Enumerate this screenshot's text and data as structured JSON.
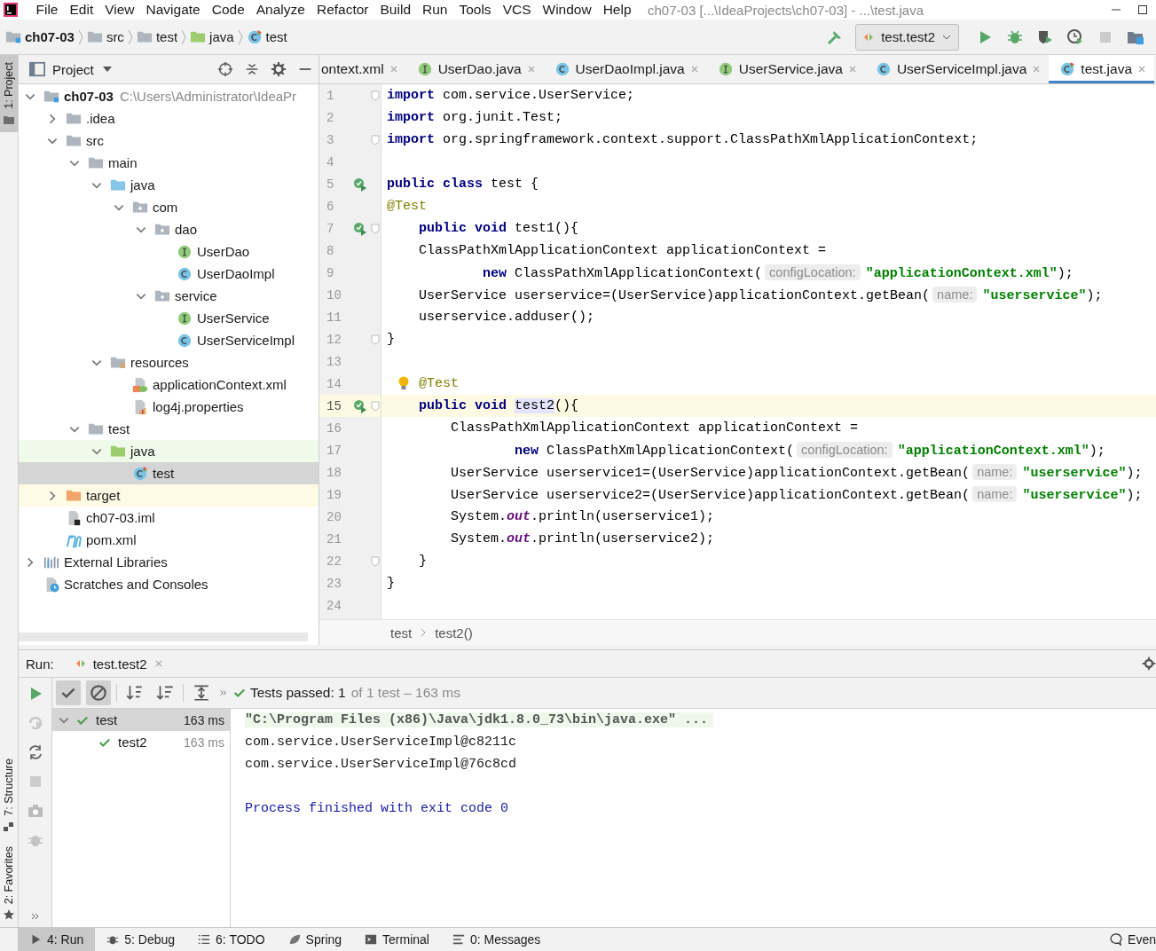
{
  "menu": [
    "File",
    "Edit",
    "View",
    "Navigate",
    "Code",
    "Analyze",
    "Refactor",
    "Build",
    "Run",
    "Tools",
    "VCS",
    "Window",
    "Help"
  ],
  "window_title": "ch07-03 [...\\IdeaProjects\\ch07-03] - ...\\test.java",
  "navigation": {
    "breadcrumbs": [
      {
        "label": "ch07-03",
        "kind": "module"
      },
      {
        "label": "src",
        "kind": "folder"
      },
      {
        "label": "test",
        "kind": "folder"
      },
      {
        "label": "java",
        "kind": "folder-test"
      },
      {
        "label": "test",
        "kind": "test-class"
      }
    ],
    "run_config": "test.test2"
  },
  "stripe_top": [
    {
      "label": "1: Project",
      "selected": true
    }
  ],
  "stripe_bottom": [
    {
      "label": "7: Structure",
      "selected": false
    },
    {
      "label": "2: Favorites",
      "selected": false
    }
  ],
  "project": {
    "title": "Project",
    "tree": [
      {
        "label": "ch07-03",
        "path": "C:\\Users\\Administrator\\IdeaPr",
        "kind": "module",
        "expanded": true,
        "selected": false,
        "children": [
          {
            "label": ".idea",
            "kind": "folder",
            "expanded": false,
            "selected": false
          },
          {
            "label": "src",
            "kind": "folder",
            "expanded": true,
            "selected": false,
            "children": [
              {
                "label": "main",
                "kind": "folder",
                "expanded": true,
                "selected": false,
                "children": [
                  {
                    "label": "java",
                    "kind": "folder-src",
                    "expanded": true,
                    "selected": false,
                    "children": [
                      {
                        "label": "com",
                        "kind": "package",
                        "expanded": true,
                        "selected": false,
                        "children": [
                          {
                            "label": "dao",
                            "kind": "package",
                            "expanded": true,
                            "selected": false,
                            "children": [
                              {
                                "label": "UserDao",
                                "kind": "interface",
                                "selected": false
                              },
                              {
                                "label": "UserDaoImpl",
                                "kind": "class",
                                "selected": false
                              }
                            ]
                          },
                          {
                            "label": "service",
                            "kind": "package",
                            "expanded": true,
                            "selected": false,
                            "children": [
                              {
                                "label": "UserService",
                                "kind": "interface",
                                "selected": false
                              },
                              {
                                "label": "UserServiceImpl",
                                "kind": "class",
                                "selected": false
                              }
                            ]
                          }
                        ]
                      }
                    ]
                  },
                  {
                    "label": "resources",
                    "kind": "folder-res",
                    "expanded": true,
                    "selected": false,
                    "children": [
                      {
                        "label": "applicationContext.xml",
                        "kind": "xml",
                        "selected": false
                      },
                      {
                        "label": "log4j.properties",
                        "kind": "properties",
                        "selected": false
                      }
                    ]
                  }
                ]
              },
              {
                "label": "test",
                "kind": "folder",
                "expanded": true,
                "selected": false,
                "children": [
                  {
                    "label": "java",
                    "kind": "folder-test",
                    "expanded": true,
                    "selected": false,
                    "children": [
                      {
                        "label": "test",
                        "kind": "test-class",
                        "selected": true
                      }
                    ]
                  }
                ]
              }
            ]
          },
          {
            "label": "target",
            "kind": "folder-excluded",
            "expanded": false,
            "selected": false
          },
          {
            "label": "ch07-03.iml",
            "kind": "iml",
            "selected": false
          },
          {
            "label": "pom.xml",
            "kind": "maven",
            "selected": false
          }
        ]
      },
      {
        "label": "External Libraries",
        "kind": "libraries",
        "expanded": false,
        "selected": false
      },
      {
        "label": "Scratches and Consoles",
        "kind": "scratches",
        "selected": false
      }
    ]
  },
  "editor": {
    "tabs": [
      {
        "label": "ontext.xml",
        "kind": "none",
        "selected": false
      },
      {
        "label": "UserDao.java",
        "kind": "interface",
        "selected": false
      },
      {
        "label": "UserDaoImpl.java",
        "kind": "class",
        "selected": false
      },
      {
        "label": "UserService.java",
        "kind": "interface",
        "selected": false
      },
      {
        "label": "UserServiceImpl.java",
        "kind": "class",
        "selected": false
      },
      {
        "label": "test.java",
        "kind": "test-class",
        "selected": true
      }
    ],
    "lines": [
      {
        "number": "1",
        "kind": "plain",
        "current": false,
        "fold": true,
        "tokens": [
          {
            "kind": "kw",
            "text": "import"
          },
          {
            "kind": "plain",
            "text": " com.service.UserService;"
          }
        ]
      },
      {
        "number": "2",
        "kind": "plain",
        "current": false,
        "fold": false,
        "tokens": [
          {
            "kind": "kw",
            "text": "import"
          },
          {
            "kind": "plain",
            "text": " org.junit.Test;"
          }
        ]
      },
      {
        "number": "3",
        "kind": "plain",
        "current": false,
        "fold": true,
        "tokens": [
          {
            "kind": "kw",
            "text": "import"
          },
          {
            "kind": "plain",
            "text": " org.springframework.context.support.ClassPathXmlApplicationContext;"
          }
        ]
      },
      {
        "number": "4",
        "kind": "plain",
        "current": false,
        "fold": false
      },
      {
        "number": "5",
        "kind": "run",
        "current": false,
        "fold": false,
        "tokens": [
          {
            "kind": "kw",
            "text": "public class"
          },
          {
            "kind": "plain",
            "text": " test {"
          }
        ]
      },
      {
        "number": "6",
        "kind": "plain",
        "current": false,
        "fold": false,
        "tokens": [
          {
            "kind": "ann",
            "text": "@Test"
          }
        ]
      },
      {
        "number": "7",
        "kind": "run",
        "current": false,
        "fold": true,
        "tokens": [
          {
            "kind": "kw",
            "text": "    public void"
          },
          {
            "kind": "plain",
            "text": " test1(){"
          }
        ]
      },
      {
        "number": "8",
        "kind": "plain",
        "current": false,
        "fold": false,
        "tokens": [
          {
            "kind": "plain",
            "text": "    ClassPathXmlApplicationContext applicationContext ="
          }
        ]
      },
      {
        "number": "9",
        "kind": "plain",
        "current": false,
        "fold": false,
        "tokens": [
          {
            "kind": "kw",
            "text": "            new"
          },
          {
            "kind": "plain",
            "text": " ClassPathXmlApplicationContext("
          },
          {
            "kind": "hint",
            "text": "configLocation:"
          },
          {
            "kind": "str",
            "text": "\"applicationContext.xml\""
          },
          {
            "kind": "plain",
            "text": ");"
          }
        ]
      },
      {
        "number": "10",
        "kind": "plain",
        "current": false,
        "fold": false,
        "tokens": [
          {
            "kind": "plain",
            "text": "    UserService userservice=(UserService)applicationContext.getBean("
          },
          {
            "kind": "hint",
            "text": "name:"
          },
          {
            "kind": "str",
            "text": "\"userservice\""
          },
          {
            "kind": "plain",
            "text": ");"
          }
        ]
      },
      {
        "number": "11",
        "kind": "plain",
        "current": false,
        "fold": false,
        "tokens": [
          {
            "kind": "plain",
            "text": "    userservice.adduser();"
          }
        ]
      },
      {
        "number": "12",
        "kind": "plain",
        "current": false,
        "fold": true,
        "tokens": [
          {
            "kind": "plain",
            "text": "}"
          }
        ]
      },
      {
        "number": "13",
        "kind": "plain",
        "current": false,
        "fold": false
      },
      {
        "number": "14",
        "kind": "bulb",
        "current": false,
        "fold": false,
        "tokens": [
          {
            "kind": "ann",
            "text": "    @Test"
          }
        ]
      },
      {
        "number": "15",
        "kind": "run",
        "current": true,
        "fold": true,
        "tokens": [
          {
            "kind": "kw",
            "text": "    public void"
          },
          {
            "kind": "hl",
            "text": " test2"
          },
          {
            "kind": "plain",
            "text": "(){"
          }
        ]
      },
      {
        "number": "16",
        "kind": "plain",
        "current": false,
        "fold": false,
        "tokens": [
          {
            "kind": "plain",
            "text": "        ClassPathXmlApplicationContext applicationContext ="
          }
        ]
      },
      {
        "number": "17",
        "kind": "plain",
        "current": false,
        "fold": false,
        "tokens": [
          {
            "kind": "kw",
            "text": "                new"
          },
          {
            "kind": "plain",
            "text": " ClassPathXmlApplicationContext("
          },
          {
            "kind": "hint",
            "text": "configLocation:"
          },
          {
            "kind": "str",
            "text": "\"applicationContext.xml\""
          },
          {
            "kind": "plain",
            "text": ");"
          }
        ]
      },
      {
        "number": "18",
        "kind": "plain",
        "current": false,
        "fold": false,
        "tokens": [
          {
            "kind": "plain",
            "text": "        UserService userservice1=(UserService)applicationContext.getBean("
          },
          {
            "kind": "hint",
            "text": "name:"
          },
          {
            "kind": "str",
            "text": "\"userservice\""
          },
          {
            "kind": "plain",
            "text": ");"
          }
        ]
      },
      {
        "number": "19",
        "kind": "plain",
        "current": false,
        "fold": false,
        "tokens": [
          {
            "kind": "plain",
            "text": "        UserService userservice2=(UserService)applicationContext.getBean("
          },
          {
            "kind": "hint",
            "text": "name:"
          },
          {
            "kind": "str",
            "text": "\"userservice\""
          },
          {
            "kind": "plain",
            "text": ");"
          }
        ]
      },
      {
        "number": "20",
        "kind": "plain",
        "current": false,
        "fold": false,
        "tokens": [
          {
            "kind": "plain",
            "text": "        System."
          },
          {
            "kind": "field",
            "text": "out"
          },
          {
            "kind": "plain",
            "text": ".println(userservice1);"
          }
        ]
      },
      {
        "number": "21",
        "kind": "plain",
        "current": false,
        "fold": false,
        "tokens": [
          {
            "kind": "plain",
            "text": "        System."
          },
          {
            "kind": "field",
            "text": "out"
          },
          {
            "kind": "plain",
            "text": ".println(userservice2);"
          }
        ]
      },
      {
        "number": "22",
        "kind": "plain",
        "current": false,
        "fold": true,
        "tokens": [
          {
            "kind": "plain",
            "text": "    }"
          }
        ]
      },
      {
        "number": "23",
        "kind": "plain",
        "current": false,
        "fold": false,
        "tokens": [
          {
            "kind": "plain",
            "text": "}"
          }
        ]
      },
      {
        "number": "24",
        "kind": "plain",
        "current": false,
        "fold": false
      }
    ],
    "breadcrumbs": [
      "test",
      "test2()"
    ]
  },
  "run": {
    "label": "Run:",
    "tab": "test.test2",
    "status": "Tests passed: 1",
    "detail": "of 1 test – 163 ms",
    "tests": [
      {
        "name": "test",
        "time": "163 ms",
        "expanded": true,
        "selected": true,
        "children": [
          {
            "name": "test2",
            "time": "163 ms",
            "selected": false
          }
        ]
      }
    ],
    "console": [
      {
        "kind": "command",
        "text": "\"C:\\Program Files (x86)\\Java\\jdk1.8.0_73\\bin\\java.exe\" ..."
      },
      {
        "kind": "output",
        "text": "com.service.UserServiceImpl@c8211c"
      },
      {
        "kind": "output",
        "text": "com.service.UserServiceImpl@76c8cd"
      },
      {
        "kind": "blank"
      },
      {
        "kind": "exit",
        "text": "Process finished with exit code 0"
      }
    ]
  },
  "tool_windows": [
    {
      "label": "4: Run",
      "kind": "run",
      "selected": true
    },
    {
      "label": "5: Debug",
      "kind": "bug",
      "selected": false
    },
    {
      "label": "6: TODO",
      "kind": "list",
      "selected": false
    },
    {
      "label": "Spring",
      "kind": "leaf",
      "selected": false
    },
    {
      "label": "Terminal",
      "kind": "terminal",
      "selected": false
    },
    {
      "label": "0: Messages",
      "kind": "messages",
      "selected": false
    }
  ],
  "event_log": "Even"
}
